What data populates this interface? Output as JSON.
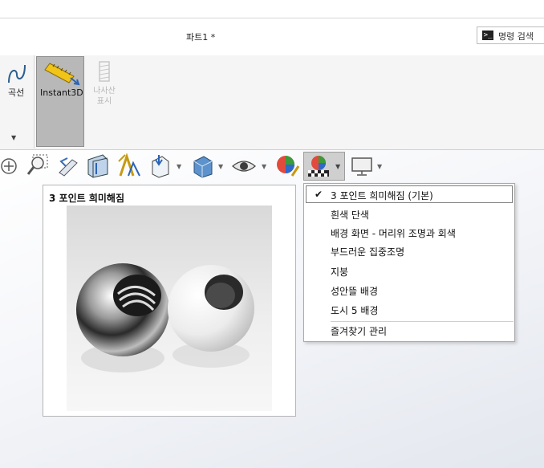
{
  "titlebar": {
    "document_title": "파트1 *",
    "command_search": {
      "icon": "command-prompt-icon",
      "label": "명령 검색"
    }
  },
  "ribbon": {
    "curve": {
      "label": "곡선",
      "icon": "curve-icon"
    },
    "instant3d": {
      "label": "Instant3D",
      "icon": "instant3d-ruler-icon",
      "active": true
    },
    "thread_display": {
      "label_line1": "나사산",
      "label_line2": "표시",
      "enabled": false
    }
  },
  "view_toolbar": {
    "items": [
      "zoom-to-fit-icon",
      "zoom-to-area-icon",
      "previous-view-icon",
      "section-view-icon",
      "dynamic-annotation-icon",
      "view-orientation-icon",
      "display-style-icon",
      "hide-show-items-icon",
      "edit-appearance-icon",
      "apply-scene-icon",
      "view-settings-icon"
    ]
  },
  "scene_preview": {
    "title": "3 포인트 희미해짐"
  },
  "scene_menu": {
    "check_glyph": "✔",
    "items": [
      {
        "label": "3 포인트 희미해짐  (기본)",
        "checked": true
      },
      {
        "label": "흰색 단색",
        "checked": false
      },
      {
        "label": "배경 화면 - 머리위 조명과 회색",
        "checked": false
      },
      {
        "label": "부드러운 집중조명",
        "checked": false
      },
      {
        "label": "지붕",
        "checked": false
      },
      {
        "label": "성안뜰 배경",
        "checked": false
      },
      {
        "label": "도시 5 배경",
        "checked": false
      }
    ],
    "manage_favorites": "즐겨찾기 관리"
  }
}
